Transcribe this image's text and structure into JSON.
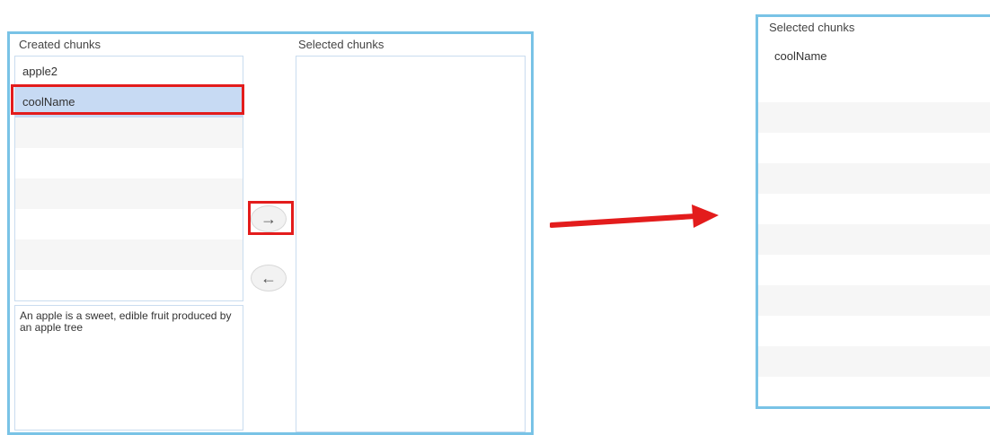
{
  "left_panel": {
    "created_label": "Created chunks",
    "selected_label": "Selected chunks",
    "created_items": [
      "apple2",
      "coolName",
      "",
      "",
      "",
      "",
      "",
      ""
    ],
    "description": "An apple is a sweet, edible fruit produced by an apple tree"
  },
  "buttons": {
    "move_right_icon": "→",
    "move_left_icon": "←"
  },
  "right_panel": {
    "selected_label": "Selected chunks",
    "selected_items": [
      "coolName",
      "",
      "",
      "",
      "",
      "",
      "",
      "",
      "",
      "",
      "",
      ""
    ]
  },
  "colors": {
    "panel_border": "#79c3e6",
    "highlight": "#e31c1c",
    "selected_row": "#c7daf3"
  }
}
